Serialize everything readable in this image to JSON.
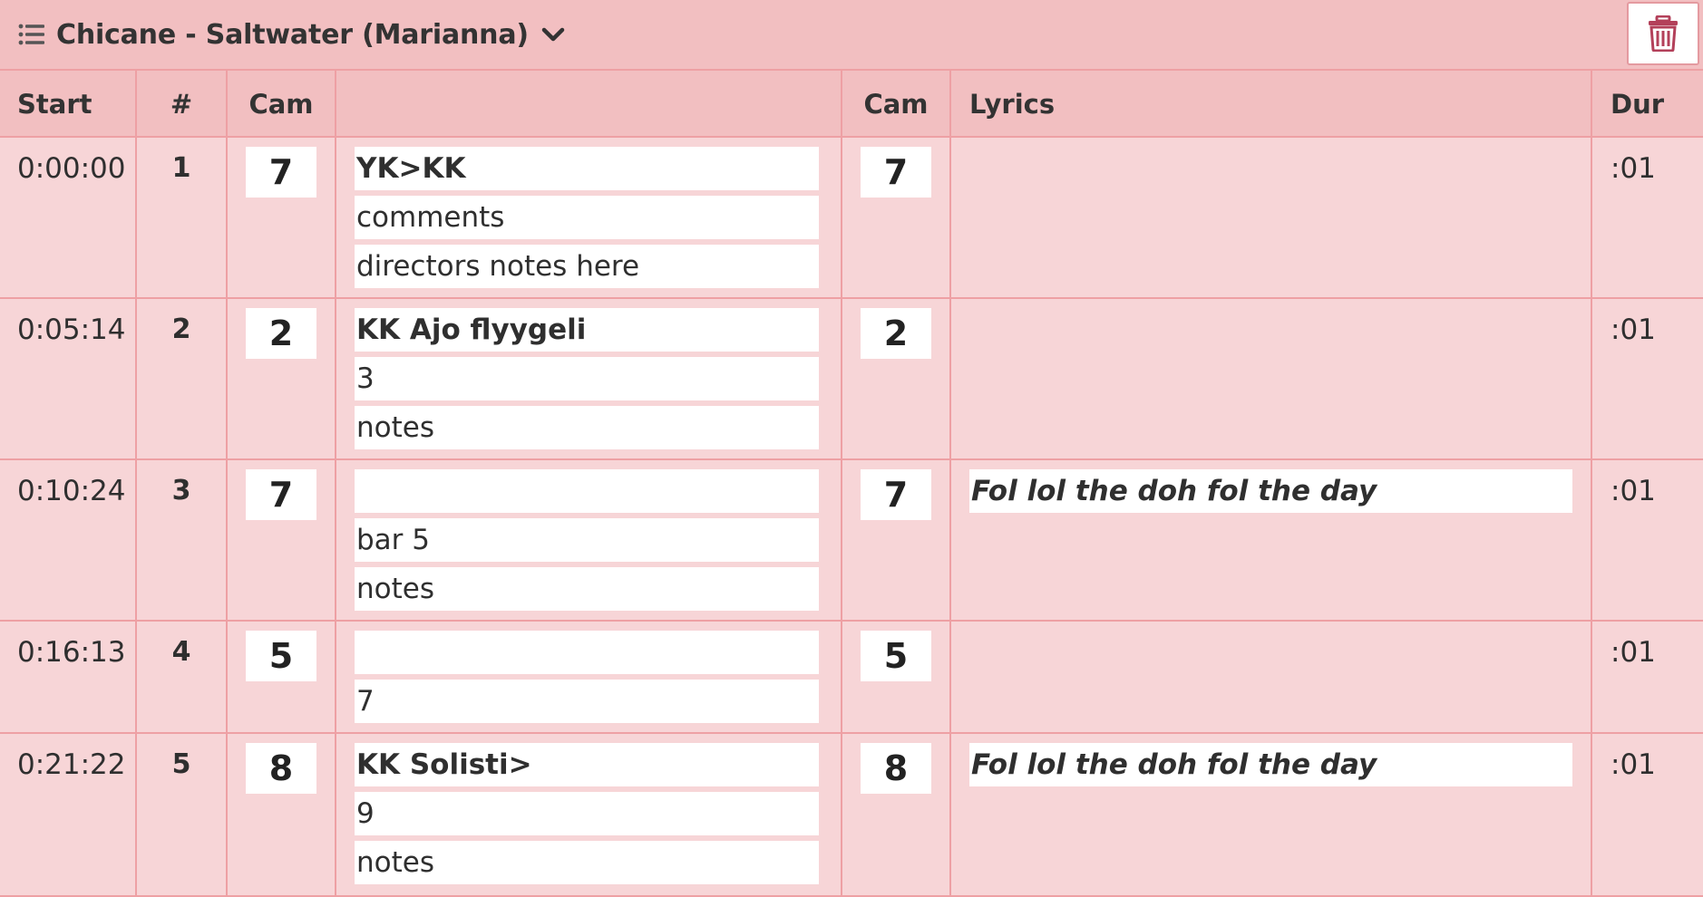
{
  "header": {
    "title": "Chicane - Saltwater (Marianna)",
    "icons": {
      "list": "list-icon",
      "dropdown": "chevron-down-icon",
      "delete": "trash-icon"
    },
    "colors": {
      "accent": "#b3405a",
      "header_bg": "#f2bfc1",
      "row_bg": "#f7d5d7",
      "border": "#eea0a4"
    }
  },
  "columns": {
    "start": "Start",
    "num": "#",
    "cam": "Cam",
    "desc": "",
    "cam2": "Cam",
    "lyrics": "Lyrics",
    "dur": "Dur"
  },
  "rows": [
    {
      "start": "0:00:00",
      "num": "1",
      "cam": "7",
      "fields": [
        "YK>KK",
        "comments",
        "directors notes here"
      ],
      "cam2": "7",
      "lyrics": "",
      "dur": ":01"
    },
    {
      "start": "0:05:14",
      "num": "2",
      "cam": "2",
      "fields": [
        "KK Ajo flyygeli",
        "3",
        "notes"
      ],
      "cam2": "2",
      "lyrics": "",
      "dur": ":01"
    },
    {
      "start": "0:10:24",
      "num": "3",
      "cam": "7",
      "fields": [
        "",
        "bar 5",
        "notes"
      ],
      "cam2": "7",
      "lyrics": "Fol lol the doh fol the day",
      "dur": ":01"
    },
    {
      "start": "0:16:13",
      "num": "4",
      "cam": "5",
      "fields": [
        "",
        "7"
      ],
      "cam2": "5",
      "lyrics": "",
      "dur": ":01"
    },
    {
      "start": "0:21:22",
      "num": "5",
      "cam": "8",
      "fields": [
        "KK Solisti>",
        "9",
        "notes"
      ],
      "cam2": "8",
      "lyrics": "Fol lol the doh fol the day",
      "dur": ":01"
    }
  ]
}
